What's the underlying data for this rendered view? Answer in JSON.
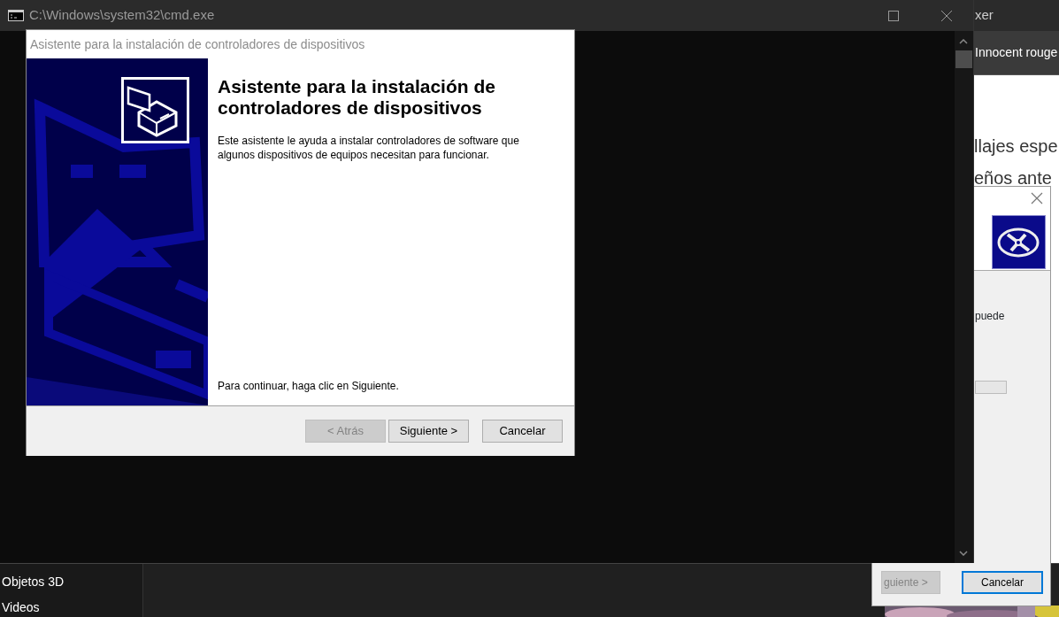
{
  "background_window": {
    "title": "xer",
    "tab": "Innocent rouge",
    "lines": [
      "llajes espe",
      "eños ante"
    ]
  },
  "explorer_sidebar": {
    "items": [
      "Objetos 3D",
      "Videos"
    ]
  },
  "back_dialog": {
    "text": "puede",
    "progress": {
      "level": 0
    },
    "buttons": [
      {
        "label": "guiente >",
        "disabled": true,
        "focused": false
      },
      {
        "label": "Cancelar",
        "disabled": false,
        "focused": true
      }
    ]
  },
  "console": {
    "title": "C:\\Windows\\system32\\cmd.exe"
  },
  "wizard": {
    "title": "Asistente para la instalación de controladores de dispositivos",
    "heading": "Asistente para la instalación de controladores de dispositivos",
    "description": "Este asistente le ayuda a instalar controladores de software que algunos dispositivos de equipos necesitan para funcionar.",
    "hint": "Para continuar, haga clic en Siguiente.",
    "buttons": [
      {
        "label": "< Atrás",
        "disabled": true
      },
      {
        "label": "Siguiente >",
        "disabled": false
      },
      {
        "label": "Cancelar",
        "disabled": false
      }
    ]
  }
}
